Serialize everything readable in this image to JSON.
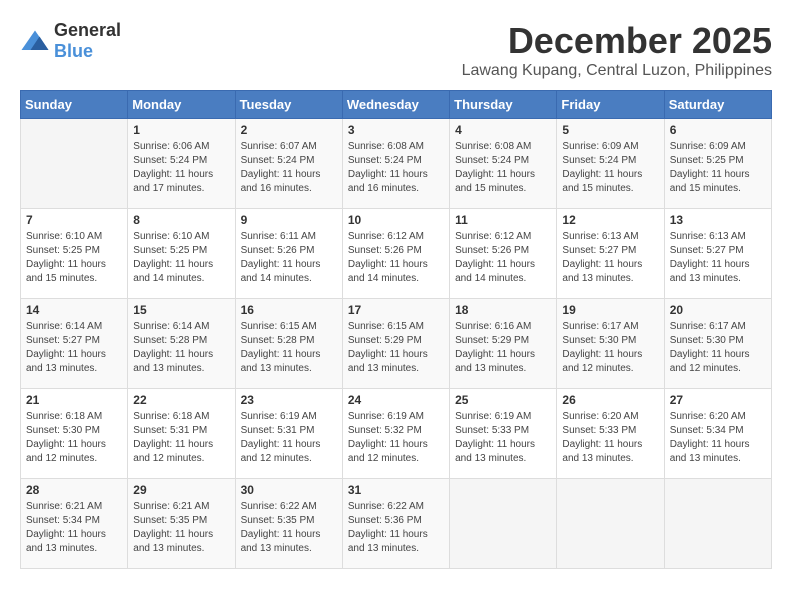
{
  "logo": {
    "general": "General",
    "blue": "Blue"
  },
  "title": "December 2025",
  "location": "Lawang Kupang, Central Luzon, Philippines",
  "headers": [
    "Sunday",
    "Monday",
    "Tuesday",
    "Wednesday",
    "Thursday",
    "Friday",
    "Saturday"
  ],
  "weeks": [
    [
      {
        "day": "",
        "info": ""
      },
      {
        "day": "1",
        "info": "Sunrise: 6:06 AM\nSunset: 5:24 PM\nDaylight: 11 hours\nand 17 minutes."
      },
      {
        "day": "2",
        "info": "Sunrise: 6:07 AM\nSunset: 5:24 PM\nDaylight: 11 hours\nand 16 minutes."
      },
      {
        "day": "3",
        "info": "Sunrise: 6:08 AM\nSunset: 5:24 PM\nDaylight: 11 hours\nand 16 minutes."
      },
      {
        "day": "4",
        "info": "Sunrise: 6:08 AM\nSunset: 5:24 PM\nDaylight: 11 hours\nand 15 minutes."
      },
      {
        "day": "5",
        "info": "Sunrise: 6:09 AM\nSunset: 5:24 PM\nDaylight: 11 hours\nand 15 minutes."
      },
      {
        "day": "6",
        "info": "Sunrise: 6:09 AM\nSunset: 5:25 PM\nDaylight: 11 hours\nand 15 minutes."
      }
    ],
    [
      {
        "day": "7",
        "info": "Sunrise: 6:10 AM\nSunset: 5:25 PM\nDaylight: 11 hours\nand 15 minutes."
      },
      {
        "day": "8",
        "info": "Sunrise: 6:10 AM\nSunset: 5:25 PM\nDaylight: 11 hours\nand 14 minutes."
      },
      {
        "day": "9",
        "info": "Sunrise: 6:11 AM\nSunset: 5:26 PM\nDaylight: 11 hours\nand 14 minutes."
      },
      {
        "day": "10",
        "info": "Sunrise: 6:12 AM\nSunset: 5:26 PM\nDaylight: 11 hours\nand 14 minutes."
      },
      {
        "day": "11",
        "info": "Sunrise: 6:12 AM\nSunset: 5:26 PM\nDaylight: 11 hours\nand 14 minutes."
      },
      {
        "day": "12",
        "info": "Sunrise: 6:13 AM\nSunset: 5:27 PM\nDaylight: 11 hours\nand 13 minutes."
      },
      {
        "day": "13",
        "info": "Sunrise: 6:13 AM\nSunset: 5:27 PM\nDaylight: 11 hours\nand 13 minutes."
      }
    ],
    [
      {
        "day": "14",
        "info": "Sunrise: 6:14 AM\nSunset: 5:27 PM\nDaylight: 11 hours\nand 13 minutes."
      },
      {
        "day": "15",
        "info": "Sunrise: 6:14 AM\nSunset: 5:28 PM\nDaylight: 11 hours\nand 13 minutes."
      },
      {
        "day": "16",
        "info": "Sunrise: 6:15 AM\nSunset: 5:28 PM\nDaylight: 11 hours\nand 13 minutes."
      },
      {
        "day": "17",
        "info": "Sunrise: 6:15 AM\nSunset: 5:29 PM\nDaylight: 11 hours\nand 13 minutes."
      },
      {
        "day": "18",
        "info": "Sunrise: 6:16 AM\nSunset: 5:29 PM\nDaylight: 11 hours\nand 13 minutes."
      },
      {
        "day": "19",
        "info": "Sunrise: 6:17 AM\nSunset: 5:30 PM\nDaylight: 11 hours\nand 12 minutes."
      },
      {
        "day": "20",
        "info": "Sunrise: 6:17 AM\nSunset: 5:30 PM\nDaylight: 11 hours\nand 12 minutes."
      }
    ],
    [
      {
        "day": "21",
        "info": "Sunrise: 6:18 AM\nSunset: 5:30 PM\nDaylight: 11 hours\nand 12 minutes."
      },
      {
        "day": "22",
        "info": "Sunrise: 6:18 AM\nSunset: 5:31 PM\nDaylight: 11 hours\nand 12 minutes."
      },
      {
        "day": "23",
        "info": "Sunrise: 6:19 AM\nSunset: 5:31 PM\nDaylight: 11 hours\nand 12 minutes."
      },
      {
        "day": "24",
        "info": "Sunrise: 6:19 AM\nSunset: 5:32 PM\nDaylight: 11 hours\nand 12 minutes."
      },
      {
        "day": "25",
        "info": "Sunrise: 6:19 AM\nSunset: 5:33 PM\nDaylight: 11 hours\nand 13 minutes."
      },
      {
        "day": "26",
        "info": "Sunrise: 6:20 AM\nSunset: 5:33 PM\nDaylight: 11 hours\nand 13 minutes."
      },
      {
        "day": "27",
        "info": "Sunrise: 6:20 AM\nSunset: 5:34 PM\nDaylight: 11 hours\nand 13 minutes."
      }
    ],
    [
      {
        "day": "28",
        "info": "Sunrise: 6:21 AM\nSunset: 5:34 PM\nDaylight: 11 hours\nand 13 minutes."
      },
      {
        "day": "29",
        "info": "Sunrise: 6:21 AM\nSunset: 5:35 PM\nDaylight: 11 hours\nand 13 minutes."
      },
      {
        "day": "30",
        "info": "Sunrise: 6:22 AM\nSunset: 5:35 PM\nDaylight: 11 hours\nand 13 minutes."
      },
      {
        "day": "31",
        "info": "Sunrise: 6:22 AM\nSunset: 5:36 PM\nDaylight: 11 hours\nand 13 minutes."
      },
      {
        "day": "",
        "info": ""
      },
      {
        "day": "",
        "info": ""
      },
      {
        "day": "",
        "info": ""
      }
    ]
  ]
}
